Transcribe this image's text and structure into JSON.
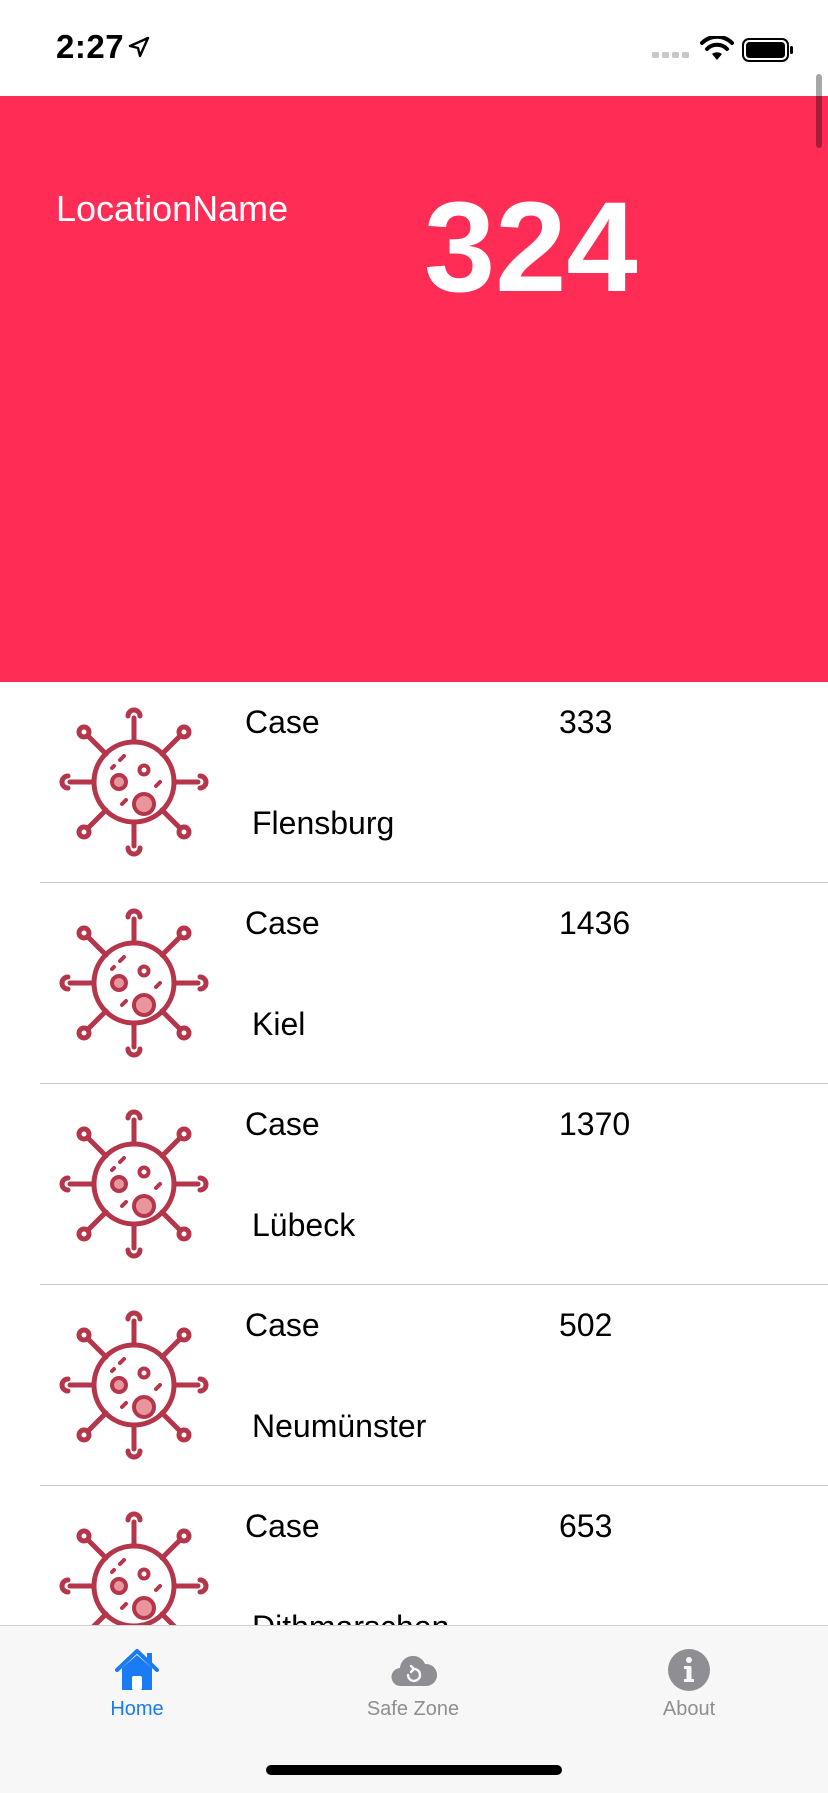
{
  "status_bar": {
    "time": "2:27"
  },
  "header": {
    "location_name": "LocationName",
    "count": "324"
  },
  "cases": [
    {
      "label": "Case",
      "value": "333",
      "city": "Flensburg"
    },
    {
      "label": "Case",
      "value": "1436",
      "city": "Kiel"
    },
    {
      "label": "Case",
      "value": "1370",
      "city": "Lübeck"
    },
    {
      "label": "Case",
      "value": "502",
      "city": "Neumünster"
    },
    {
      "label": "Case",
      "value": "653",
      "city": "Dithmarschen"
    }
  ],
  "tab_bar": {
    "home": "Home",
    "safe_zone": "Safe Zone",
    "about": "About",
    "active": "Home"
  },
  "colors": {
    "header_bg": "#ff2d55",
    "virus_icon": "#b5364a",
    "active_tab": "#1a7cf5",
    "inactive_tab": "#8e8e93"
  },
  "icons": {
    "row_icon": "virus-icon",
    "home": "house-icon",
    "safe_zone": "cloud-refresh-icon",
    "about": "info-icon"
  }
}
